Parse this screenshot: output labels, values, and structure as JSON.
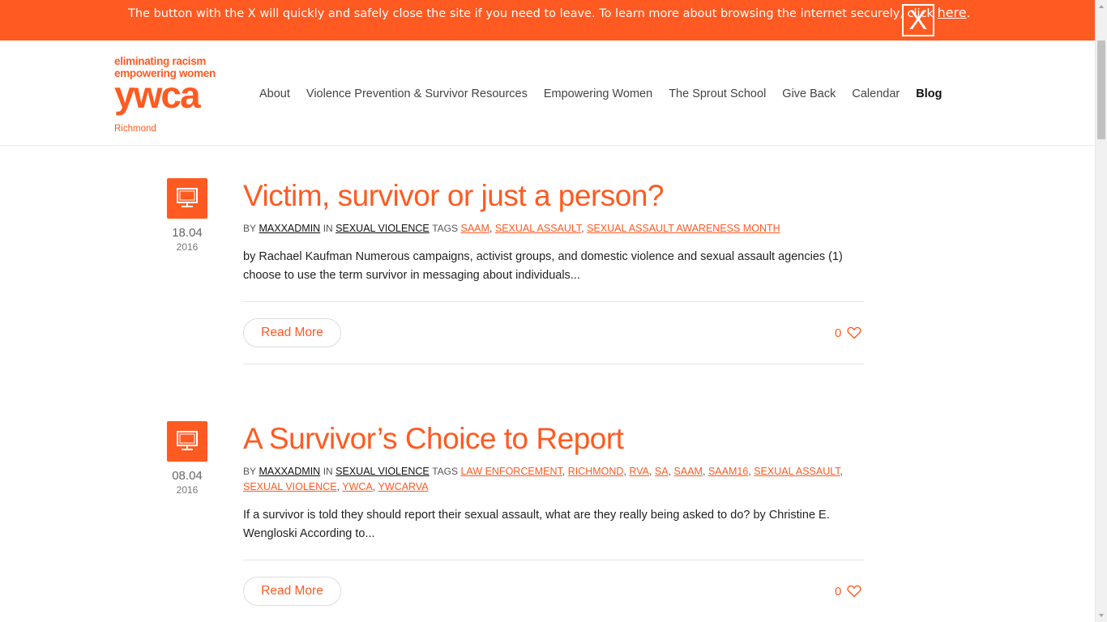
{
  "alert": {
    "text": "The button with the X will quickly and safely close the site if you need to leave. To learn more about browsing the internet securely, click ",
    "link_text": "here",
    "after": ".",
    "close_label": "X"
  },
  "logo": {
    "line1": "eliminating racism",
    "line2": "empowering women",
    "mark": "ywca",
    "sub": "Richmond"
  },
  "nav": {
    "items": [
      "About",
      "Violence Prevention & Survivor Resources",
      "Empowering Women",
      "The Sprout School",
      "Give Back",
      "Calendar",
      "Blog"
    ]
  },
  "posts": [
    {
      "title": "Victim, survivor or just a person?",
      "date": "18.04",
      "year": "2016",
      "by_label": "BY",
      "author": "MAXXADMIN",
      "in_label": "IN",
      "category": "SEXUAL VIOLENCE",
      "tags_label": "TAGS",
      "tags": [
        "SAAM",
        "SEXUAL ASSAULT",
        "SEXUAL ASSAULT AWARENESS MONTH"
      ],
      "excerpt": "  by Rachael Kaufman Numerous campaigns, activist groups, and domestic violence and sexual assault agencies (1) choose to use the term survivor in messaging about individuals...",
      "read_more": "Read More",
      "likes": "0"
    },
    {
      "title": "A Survivor’s Choice to Report",
      "date": "08.04",
      "year": "2016",
      "by_label": "BY",
      "author": "MAXXADMIN",
      "in_label": "IN",
      "category": "SEXUAL VIOLENCE",
      "tags_label": "TAGS",
      "tags": [
        "LAW ENFORCEMENT",
        "RICHMOND",
        "RVA",
        "SA",
        "SAAM",
        "SAAM16",
        "SEXUAL ASSAULT",
        "SEXUAL VIOLENCE",
        "YWCA",
        "YWCARVA"
      ],
      "excerpt": "If a survivor is told they should report their sexual assault, what are they really being asked to do? by Christine E. Wengloski According to...",
      "read_more": "Read More",
      "likes": "0"
    }
  ],
  "colors": {
    "accent": "#ff5a21",
    "text": "#222222"
  },
  "icons": {
    "post_format": "monitor-icon",
    "like": "heart-icon",
    "close": "close-icon"
  }
}
